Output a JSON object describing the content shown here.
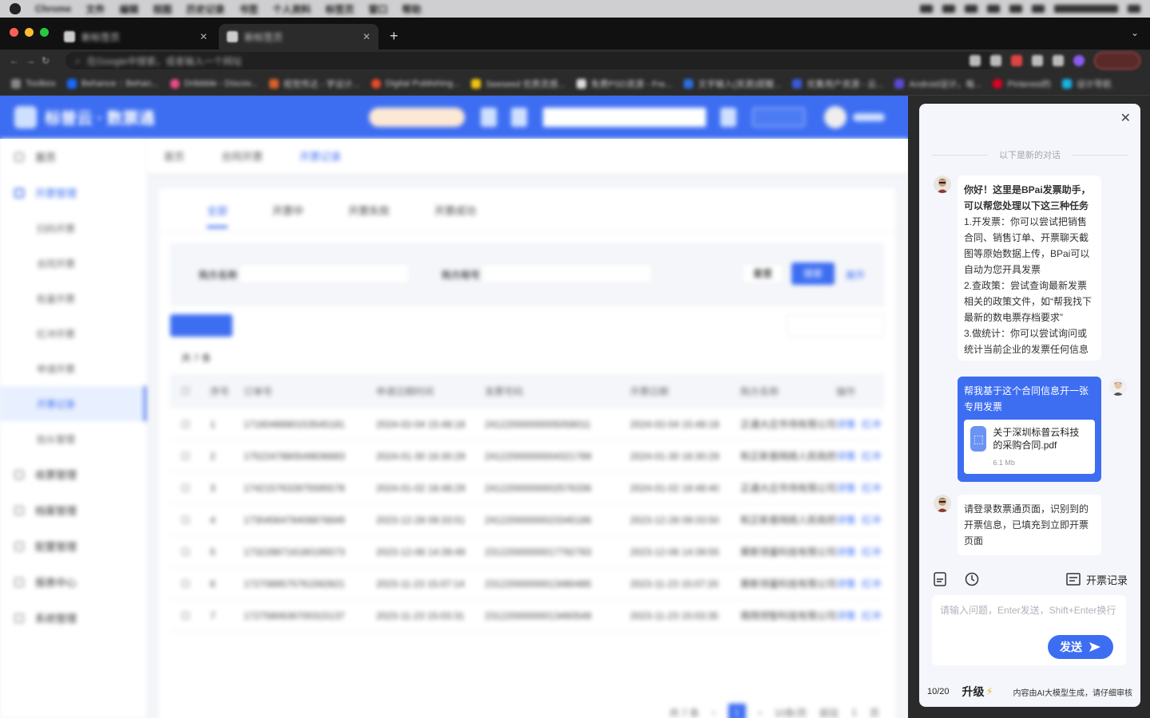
{
  "menubar": {
    "app": "Chrome",
    "items": [
      "文件",
      "编辑",
      "视图",
      "历史记录",
      "书签",
      "个人资料",
      "标签页",
      "窗口",
      "帮助"
    ]
  },
  "browser": {
    "tabs": [
      {
        "title": "新标签页"
      },
      {
        "title": "新标签页"
      }
    ],
    "omnibox_placeholder": "在Google中搜索，或者输入一个网址",
    "bookmarks": [
      "Toolbox",
      "Behance :: Behan...",
      "Dribbble - Discov...",
      "视觉传达 - 学设计...",
      "Digital Publishing...",
      "Seeseed 优质灵感...",
      "免费PSD资源 - Fre...",
      "文字输入(资源)提醒...",
      "优集用户资源 - 云...",
      "Android设计，每...",
      "Pinterest的",
      "设计导航"
    ]
  },
  "app": {
    "brand": "标普云 · 数票通",
    "sidebar": [
      {
        "label": "首页",
        "type": "head"
      },
      {
        "label": "开票管理",
        "type": "group"
      },
      {
        "label": "扫码开票",
        "type": "sub"
      },
      {
        "label": "合同开票",
        "type": "sub"
      },
      {
        "label": "批量开票",
        "type": "sub"
      },
      {
        "label": "红冲开票",
        "type": "sub"
      },
      {
        "label": "申请开票",
        "type": "sub"
      },
      {
        "label": "开票记录",
        "type": "sub-active"
      },
      {
        "label": "抬头管理",
        "type": "sub"
      },
      {
        "label": "收票管理",
        "type": "group"
      },
      {
        "label": "档案管理",
        "type": "group"
      },
      {
        "label": "配置管理",
        "type": "group"
      },
      {
        "label": "报表中心",
        "type": "group"
      },
      {
        "label": "系统管理",
        "type": "group"
      }
    ],
    "subtabs": [
      "首页",
      "合同开票",
      "开票记录"
    ],
    "tabs": [
      "全部",
      "开票中",
      "开票失败",
      "开票成功"
    ],
    "filter": {
      "buyer_label": "购方名称",
      "tax_label": "购方税号",
      "reset": "重置",
      "search": "搜索",
      "expand": "展开"
    },
    "table": {
      "headers": [
        "序号",
        "订单号",
        "申请日期时间",
        "发票号码",
        "开票日期",
        "购方名称",
        "操作"
      ],
      "rows": [
        [
          "1",
          "1716048680153545181",
          "2024-02-04 15:48:18",
          "24122000000005058011",
          "2024-02-04 15:48:18",
          "正通大庄市场有限公司"
        ],
        [
          "2",
          "1752247880549836683",
          "2024-01-30 16:30:29",
          "24122000000004321789",
          "2024-01-30 16:30:29",
          "和正新普网络人民政府"
        ],
        [
          "3",
          "1742157632875595578",
          "2024-01-02 18:48:29",
          "24122000000002576336",
          "2024-01-02 18:48:40",
          "正通大庄市场有限公司"
        ],
        [
          "4",
          "1730456478408876849",
          "2023-12-28 09:33:51",
          "24122000000023345186",
          "2023-12-28 09:33:50",
          "和正新普网络人民政府"
        ],
        [
          "5",
          "1732288716180195573",
          "2023-12-06 14:39:49",
          "23122000000017792783",
          "2023-12-06 14:39:55",
          "赛斯领量科技有限公司"
        ],
        [
          "6",
          "1727089575761592821",
          "2023-11-23 15:07:14",
          "23122000000013480485",
          "2023-11-23 15:07:20",
          "赛斯领量科技有限公司"
        ],
        [
          "7",
          "1727580636700315137",
          "2023-11-23 15:03:31",
          "23122000000013460549",
          "2023-11-23 15:03:35",
          "南翔领智科技有限公司"
        ]
      ],
      "op_view": "详情",
      "op_more": "红冲"
    },
    "pager": {
      "total": "共 7 条",
      "page": "1",
      "size": "10条/页",
      "goto": "前往",
      "page_input": "1",
      "page_unit": "页"
    }
  },
  "assistant": {
    "divider": "以下是新的对话",
    "bot_greeting_title": "你好！这里是BPai发票助手，可以帮您处理以下这三种任务",
    "bot_greeting_items": [
      "1.开发票：你可以尝试把销售合同、销售订单、开票聊天截图等原始数据上传，BPai可以自动为您开具发票",
      "2.查政策：尝试查询最新发票相关的政策文件，如“帮我找下最新的数电票存档要求”",
      "3.做统计：你可以尝试询问或统计当前企业的发票任何信息"
    ],
    "user_message": "帮我基于这个合同信息开一张专用发票",
    "file_name": "关于深圳标普云科技的采购合同.pdf",
    "file_size": "6.1 Mb",
    "bot_reply": "请登录数票通页面，识别到的开票信息，已填充到立即开票页面",
    "records_label": "开票记录",
    "input_placeholder": "请输入问题，Enter发送，Shift+Enter换行",
    "send_label": "发送",
    "quota": "10/20",
    "upgrade_label": "升级",
    "disclaimer": "内容由AI大模型生成，请仔细审核"
  }
}
